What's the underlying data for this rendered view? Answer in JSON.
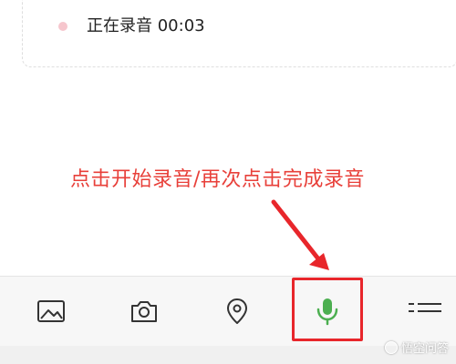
{
  "recording": {
    "status_text": "正在录音 00:03"
  },
  "annotation": {
    "text": "点击开始录音/再次点击完成录音"
  },
  "toolbar": {
    "icons": [
      "image-icon",
      "camera-icon",
      "location-icon",
      "microphone-icon",
      "list-icon"
    ],
    "accent_color": "#4caf50",
    "highlight_color": "#e8262b"
  },
  "watermark": {
    "text": "悟空问答"
  }
}
